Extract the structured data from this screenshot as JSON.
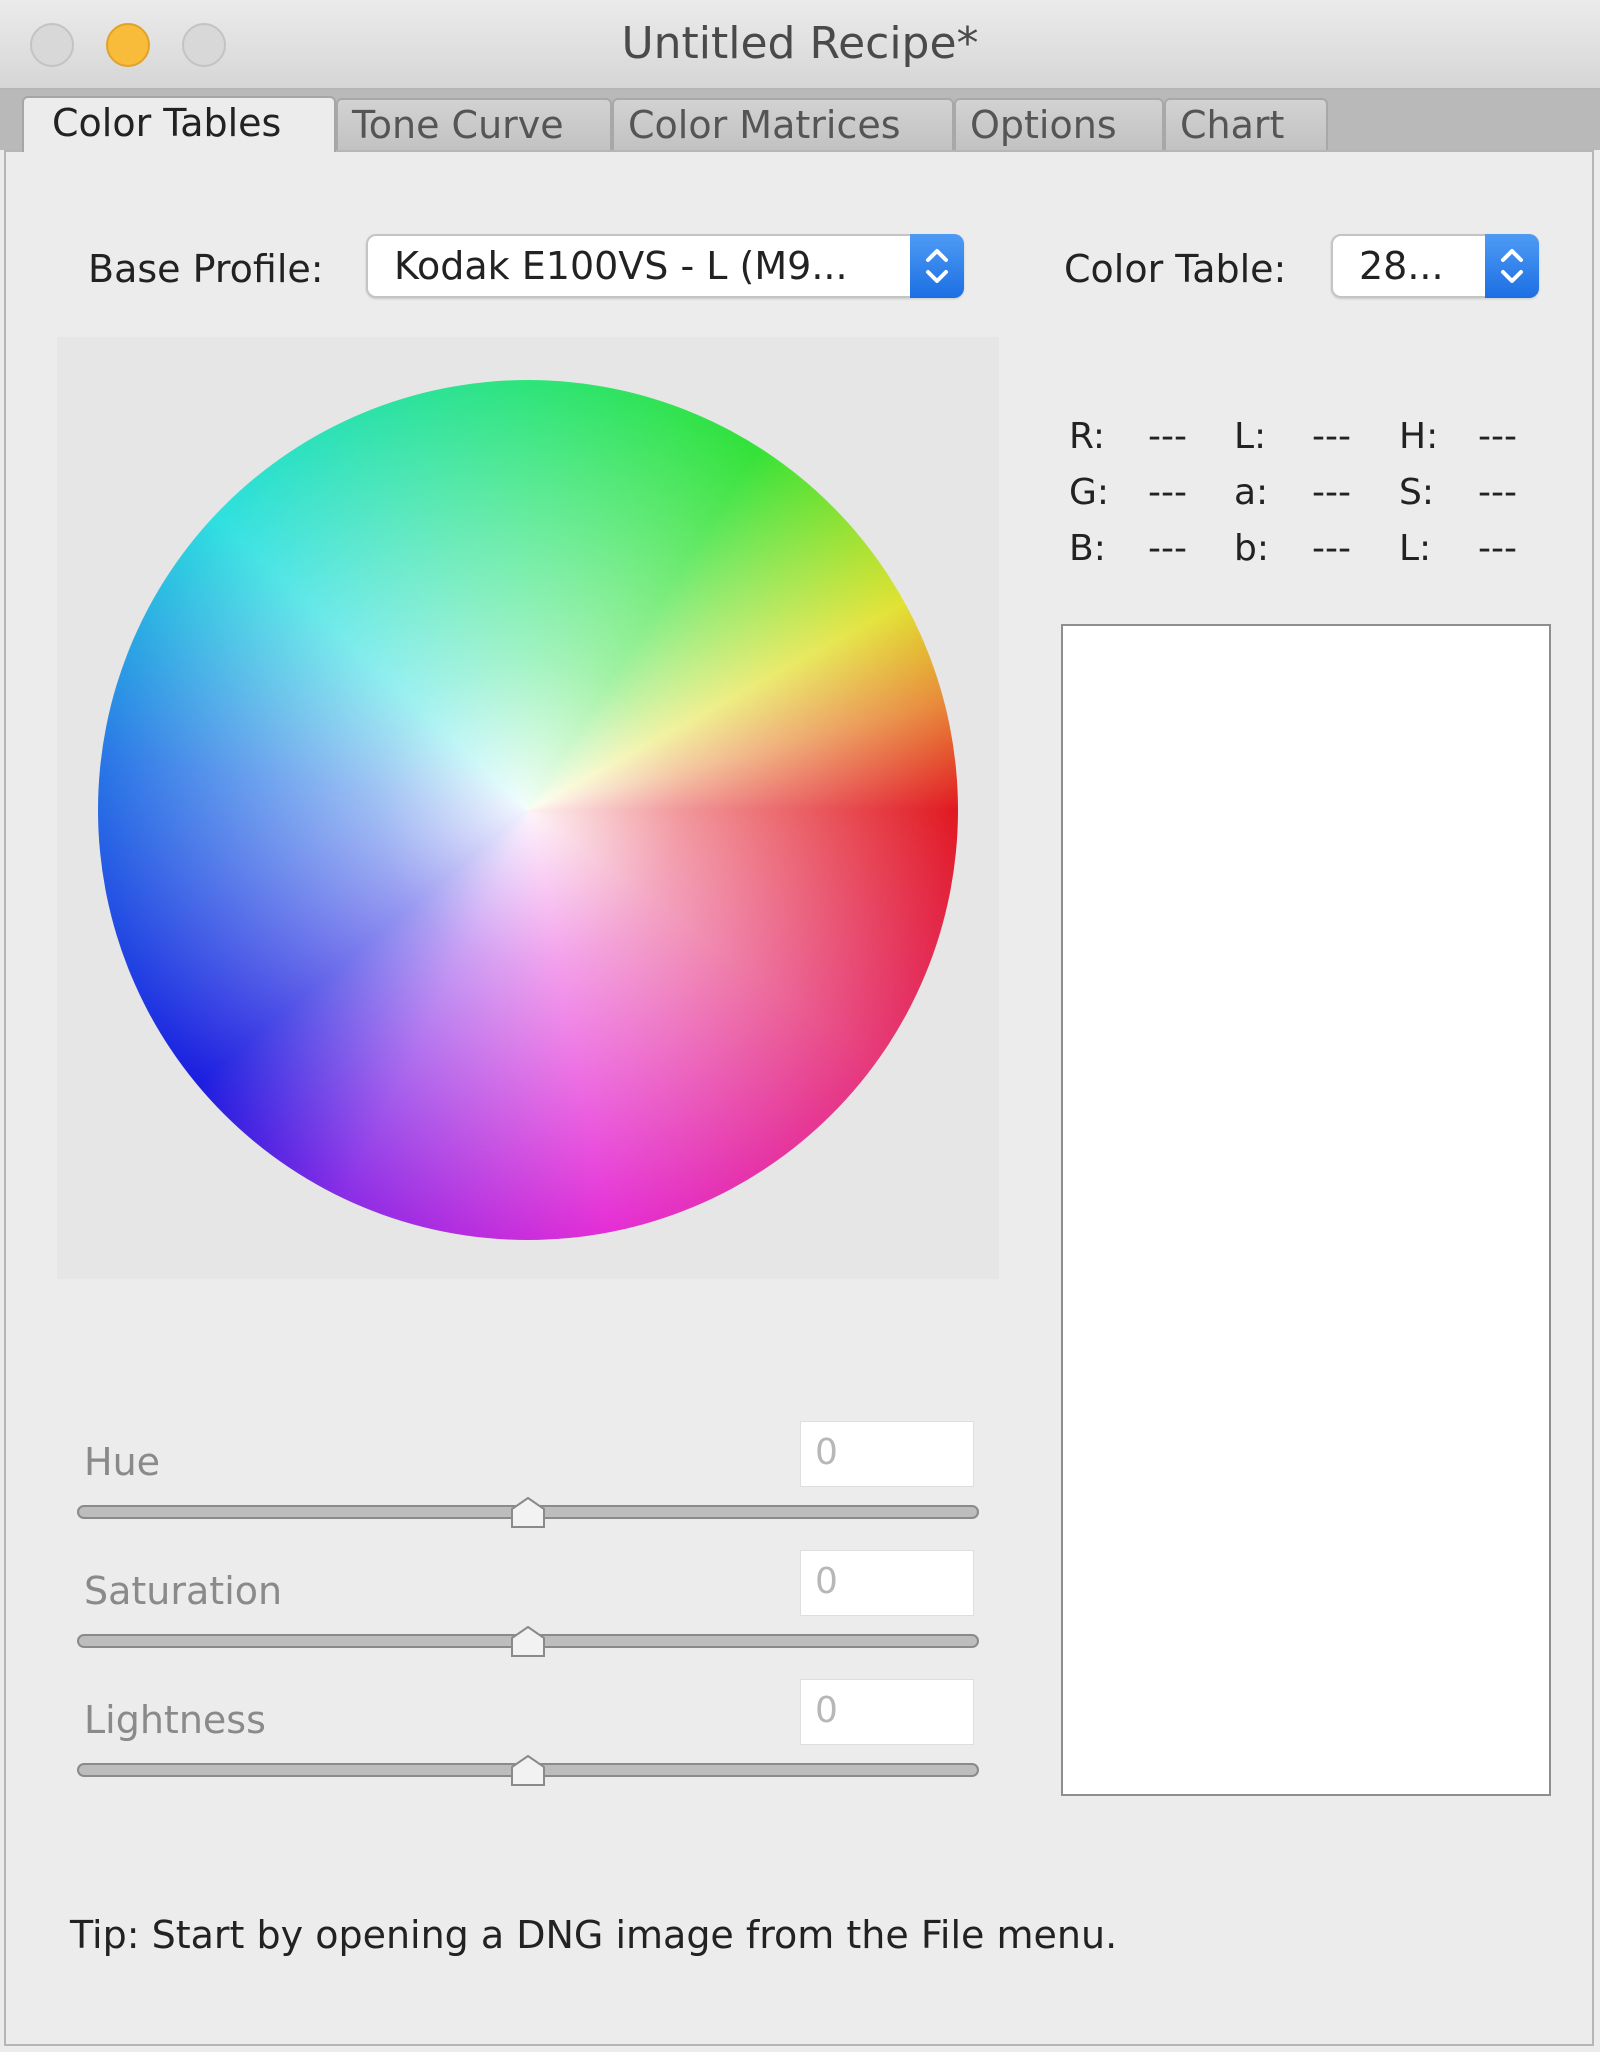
{
  "window": {
    "title": "Untitled Recipe*"
  },
  "tabs": [
    {
      "label": "Color Tables",
      "active": true
    },
    {
      "label": "Tone Curve",
      "active": false
    },
    {
      "label": "Color Matrices",
      "active": false
    },
    {
      "label": "Options",
      "active": false
    },
    {
      "label": "Chart",
      "active": false
    }
  ],
  "base_profile": {
    "label": "Base Profile:",
    "value": "Kodak E100VS - L (M9..."
  },
  "color_table": {
    "label": "Color Table:",
    "value": "28..."
  },
  "readouts": {
    "r_label": "R:",
    "r_value": "---",
    "g_label": "G:",
    "g_value": "---",
    "b_label": "B:",
    "b_value": "---",
    "l_label": "L:",
    "l_value": "---",
    "a_label": "a:",
    "a_value": "---",
    "lab_b_label": "b:",
    "lab_b_value": "---",
    "h_label": "H:",
    "h_value": "---",
    "s_label": "S:",
    "s_value": "---",
    "hsl_l_label": "L:",
    "hsl_l_value": "---"
  },
  "sliders": [
    {
      "label": "Hue",
      "value": "0",
      "position": 0.5
    },
    {
      "label": "Saturation",
      "value": "0",
      "position": 0.5
    },
    {
      "label": "Lightness",
      "value": "0",
      "position": 0.5
    }
  ],
  "tip": "Tip: Start by opening a DNG image from the File menu.",
  "colors": {
    "accent": "#1c6fe3",
    "minimize": "#f8bc3a",
    "disabled_text": "#8a8a8a"
  },
  "icons": {
    "close": "close-button-icon",
    "minimize": "minimize-button-icon",
    "zoom": "zoom-button-icon",
    "popup_arrows": "up-down-chevron-icon"
  }
}
